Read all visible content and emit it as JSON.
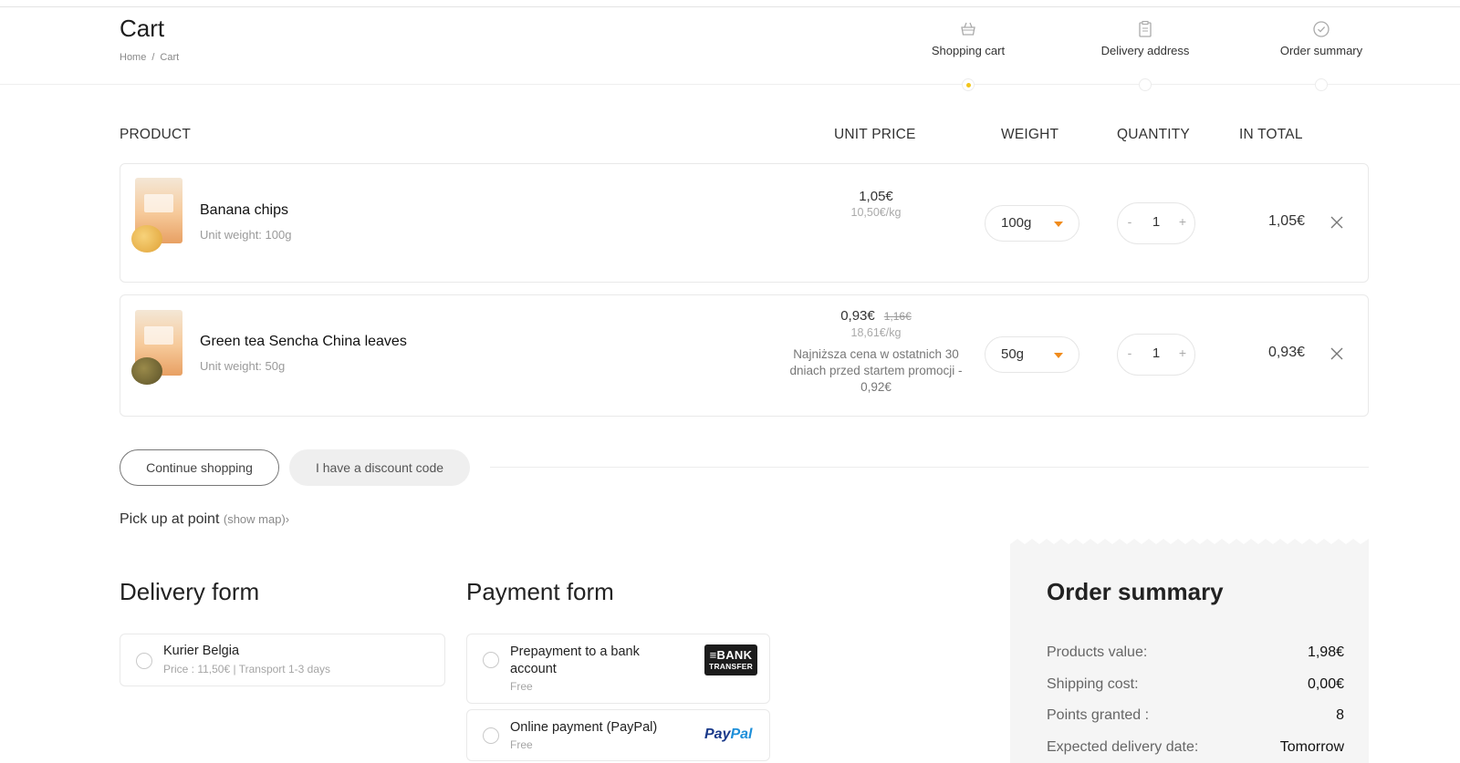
{
  "header": {
    "title": "Cart",
    "breadcrumb": [
      "Home",
      "Cart"
    ],
    "breadcrumb_sep": "/",
    "steps": [
      {
        "label": "Shopping cart",
        "icon": "basket-icon",
        "active": true
      },
      {
        "label": "Delivery address",
        "icon": "clipboard-icon",
        "active": false
      },
      {
        "label": "Order summary",
        "icon": "check-circle-icon",
        "active": false
      }
    ],
    "accent_color": "#f2c51c"
  },
  "table": {
    "columns": [
      "PRODUCT",
      "UNIT PRICE",
      "WEIGHT",
      "QUANTITY",
      "IN TOTAL"
    ],
    "rows": [
      {
        "name": "Banana chips",
        "unit_weight": "Unit weight: 100g",
        "price": "1,05€",
        "price_old": "",
        "price_per_kg": "10,50€/kg",
        "note": "",
        "weight": "100g",
        "quantity": "1",
        "total": "1,05€"
      },
      {
        "name": "Green tea Sencha China leaves",
        "unit_weight": "Unit weight: 50g",
        "price": "0,93€",
        "price_old": "1,16€",
        "price_per_kg": "18,61€/kg",
        "note": "Najniższa cena w ostatnich 30 dniach przed startem promocji - 0,92€",
        "weight": "50g",
        "quantity": "1",
        "total": "0,93€"
      }
    ],
    "qty_minus": "-",
    "qty_plus": "+"
  },
  "actions": {
    "continue_label": "Continue shopping",
    "discount_label": "I have a discount code"
  },
  "pickup": {
    "label": "Pick up at point",
    "map_link": "(show map)",
    "chevron": "›"
  },
  "delivery": {
    "title": "Delivery form",
    "options": [
      {
        "name": "Kurier Belgia",
        "details": "Price : 11,50€  |  Transport 1-3 days"
      }
    ]
  },
  "payment": {
    "title": "Payment form",
    "options": [
      {
        "name": "Prepayment to a bank account",
        "fee": "Free",
        "logo_line1": "≡BANK",
        "logo_line2": "TRANSFER"
      },
      {
        "name": "Online payment (PayPal)",
        "fee": "Free",
        "logo_pay": "Pay",
        "logo_pal": "Pal"
      }
    ]
  },
  "summary": {
    "title": "Order summary",
    "rows": [
      {
        "label": "Products value:",
        "value": "1,98€"
      },
      {
        "label": "Shipping cost:",
        "value": "0,00€"
      },
      {
        "label": "Points granted :",
        "value": "8"
      },
      {
        "label": "Expected delivery date:",
        "value": "Tomorrow"
      }
    ]
  }
}
